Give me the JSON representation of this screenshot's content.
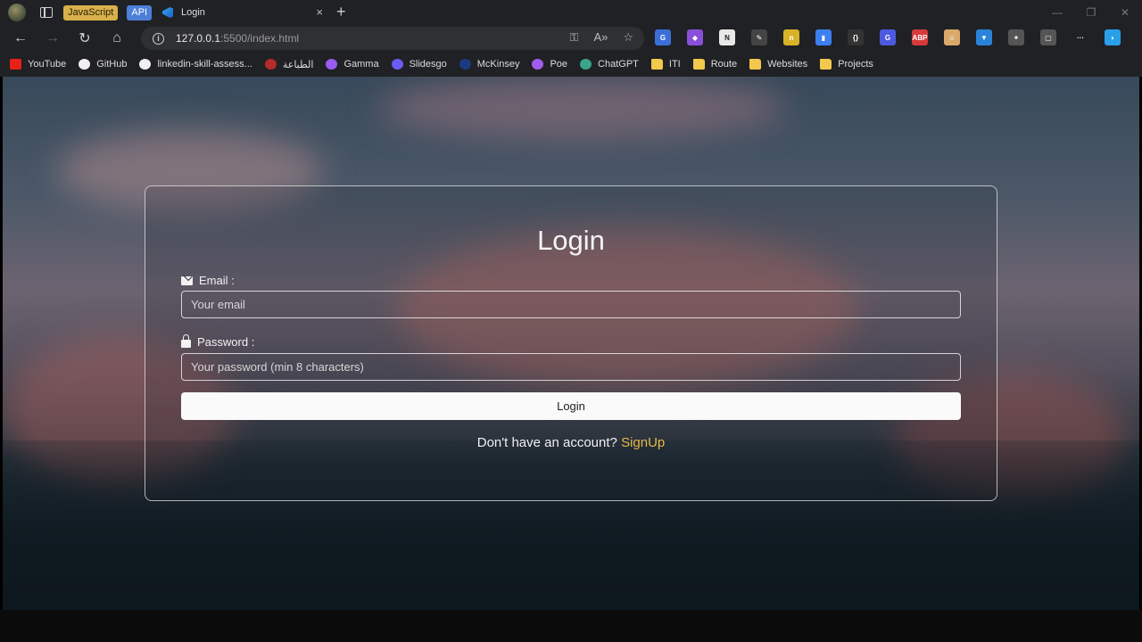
{
  "browser": {
    "tab_groups": [
      "JavaScript",
      "API"
    ],
    "active_tab": {
      "title": "Login",
      "icon": "vscode-live-server-icon"
    },
    "tab_close": "×",
    "new_tab": "+",
    "window_controls": [
      "—",
      "❐",
      "✕"
    ],
    "url_host": "127.0.0.1",
    "url_path": ":5500/index.html",
    "nav_icons": {
      "back": "←",
      "forward": "→",
      "reload": "↻",
      "home": "⌂"
    },
    "address_icons": [
      "⚿",
      "A»",
      "☆"
    ],
    "extensions": [
      {
        "name": "translate-icon",
        "label": "G",
        "color": "#3b6fd8"
      },
      {
        "name": "paint-icon",
        "label": "◆",
        "color": "#8a4fd8"
      },
      {
        "name": "notion-icon",
        "label": "N",
        "color": "#e8e8e8"
      },
      {
        "name": "picker-icon",
        "label": "✎",
        "color": "#444"
      },
      {
        "name": "dictionary-icon",
        "label": "n",
        "color": "#d8b32a"
      },
      {
        "name": "docs-icon",
        "label": "▮",
        "color": "#3d7ef0"
      },
      {
        "name": "json-icon",
        "label": "{}",
        "color": "#333"
      },
      {
        "name": "grammar-icon",
        "label": "G",
        "color": "#4d5ae0"
      },
      {
        "name": "adblock-icon",
        "label": "ABP",
        "color": "#d63a3a"
      },
      {
        "name": "face-icon",
        "label": "☺",
        "color": "#d9a86a"
      },
      {
        "name": "shield-icon",
        "label": "▼",
        "color": "#2a83d8"
      },
      {
        "name": "puzzle-icon",
        "label": "✦",
        "color": "#555"
      },
      {
        "name": "split-screen-icon",
        "label": "▢",
        "color": "#555"
      },
      {
        "name": "more-icon",
        "label": "···",
        "color": "#202124"
      },
      {
        "name": "copilot-icon",
        "label": "◗",
        "color": "#2aa0e8"
      }
    ]
  },
  "bookmarks": [
    {
      "label": "YouTube",
      "icon": "youtube-icon",
      "color": "#e62117"
    },
    {
      "label": "GitHub",
      "icon": "github-icon",
      "color": "#f0f0f0"
    },
    {
      "label": "linkedin-skill-assess...",
      "icon": "github-icon",
      "color": "#f0f0f0"
    },
    {
      "label": "الطباعة",
      "icon": "print-icon",
      "color": "#b52a2a"
    },
    {
      "label": "Gamma",
      "icon": "gamma-icon",
      "color": "#9a5cf0"
    },
    {
      "label": "Slidesgo",
      "icon": "slidesgo-icon",
      "color": "#6a5cf0"
    },
    {
      "label": "McKinsey",
      "icon": "mckinsey-icon",
      "color": "#1a3b80"
    },
    {
      "label": "Poe",
      "icon": "poe-icon",
      "color": "#a25cf0"
    },
    {
      "label": "ChatGPT",
      "icon": "chatgpt-icon",
      "color": "#3aa58a"
    },
    {
      "label": "ITI",
      "icon": "folder-icon",
      "color": "#f2c94c"
    },
    {
      "label": "Route",
      "icon": "folder-icon",
      "color": "#f2c94c"
    },
    {
      "label": "Websites",
      "icon": "folder-icon",
      "color": "#f2c94c"
    },
    {
      "label": "Projects",
      "icon": "folder-icon",
      "color": "#f2c94c"
    }
  ],
  "page": {
    "title": "Login",
    "email_label": "Email :",
    "email_placeholder": "Your email",
    "email_value": "",
    "password_label": "Password :",
    "password_placeholder": "Your password (min 8 characters)",
    "password_value": "",
    "login_button": "Login",
    "signup_prompt": "Don't have an account?",
    "signup_link": "SignUp",
    "accent_color": "#e8b94a"
  }
}
